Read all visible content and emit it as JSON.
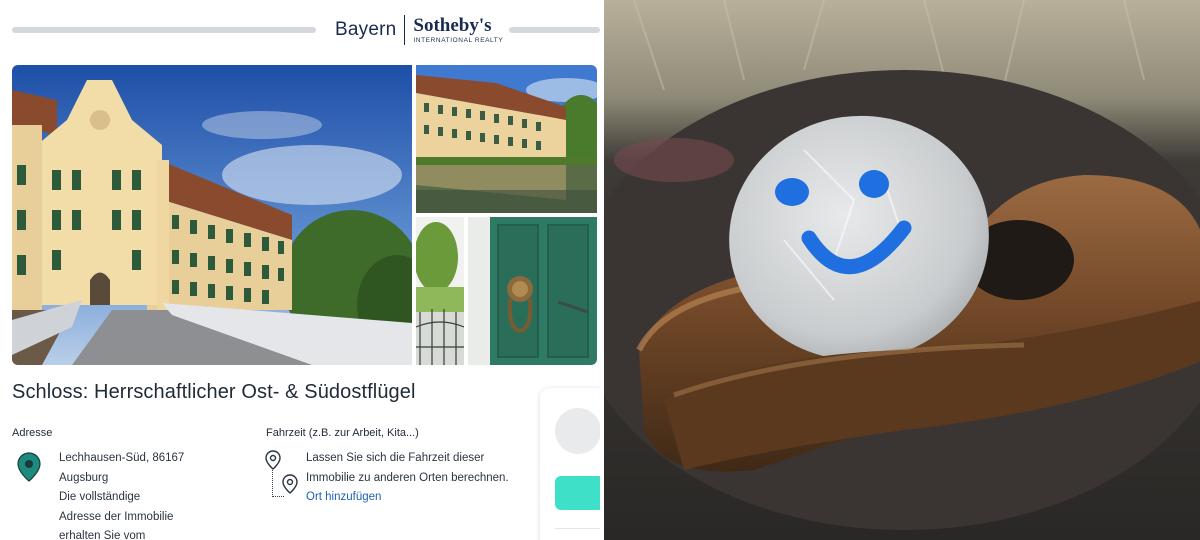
{
  "header": {
    "brand_left": "Bayern",
    "brand_name": "Sotheby's",
    "brand_tagline": "INTERNATIONAL REALTY"
  },
  "listing": {
    "title": "Schloss: Herrschaftlicher Ost- & Südostflügel",
    "address": {
      "label": "Adresse",
      "lines": [
        "Lechhausen-Süd, 86167",
        "Augsburg",
        "Die vollständige",
        "Adresse der Immobilie",
        "erhalten Sie vom"
      ]
    },
    "travel_time": {
      "label": "Fahrzeit (z.B. zur Arbeit, Kita...)",
      "lines": [
        "Lassen Sie sich die Fahrzeit dieser",
        "Immobilie zu anderen Orten berechnen."
      ],
      "link": "Ort hinzufügen"
    }
  },
  "photos": {
    "main": "castle-facade-photo",
    "top_right": "castle-reflection-photo",
    "bottom_left": "garden-gate-photo",
    "bottom_right": "green-door-knocker-photo"
  },
  "right_image": {
    "subject": "smiley-stone-photo"
  },
  "colors": {
    "brand_navy": "#1a2b50",
    "link_blue": "#1f5fb4",
    "pin_teal": "#1d8a7e",
    "cta_mint": "#3fe0c8",
    "smiley_blue": "#1f6fe0"
  }
}
